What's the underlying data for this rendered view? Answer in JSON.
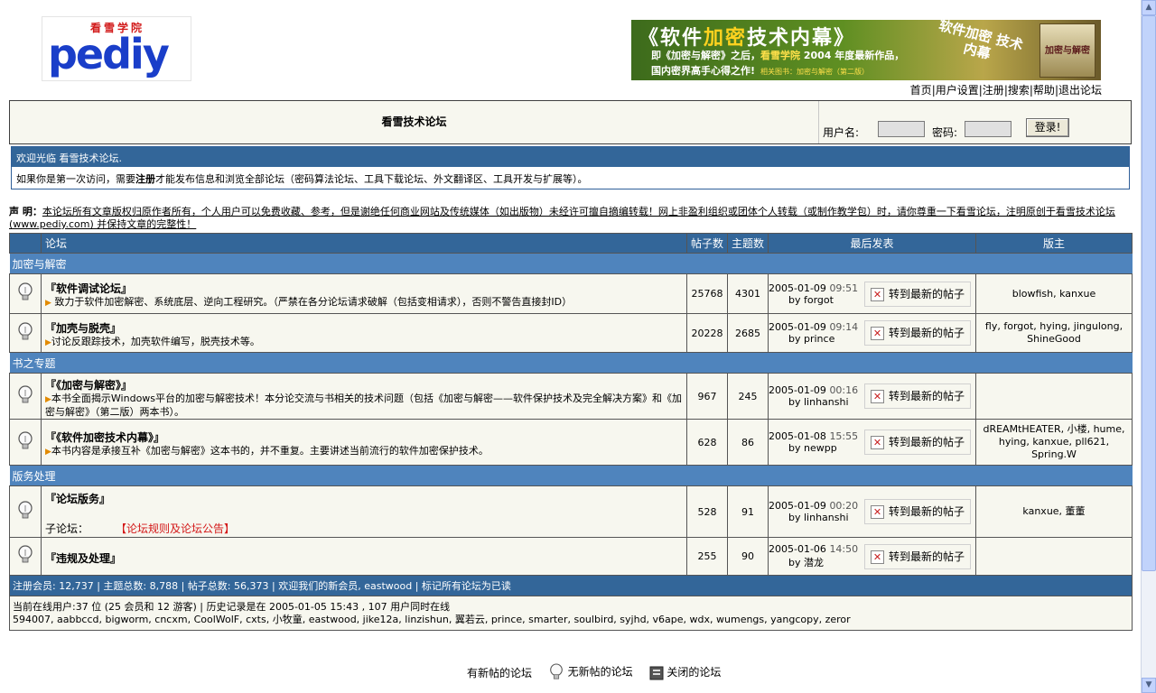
{
  "header": {
    "logo_top": "看雪学院",
    "logo_word": "pediy",
    "banner": {
      "title_open": "《软件",
      "title_hl": "加密",
      "title_close": "技术内幕》",
      "sub1_a": "即《加密与解密》之后，",
      "sub1_hl": "看雪学院",
      "sub1_b": " 2004 年度最新作品，",
      "sub2": "国内密界高手心得之作!",
      "sub2_small": "相关图书：加密与解密（第二版）",
      "slogan": "软件加密 技术内幕",
      "book": "加密与解密"
    },
    "links": [
      "首页",
      "用户设置",
      "注册",
      "搜索",
      "帮助",
      "退出论坛"
    ]
  },
  "title": "看雪技术论坛",
  "login": {
    "username_label": "用户名:",
    "password_label": "密码:",
    "button": "登录!"
  },
  "welcome": {
    "head": "欢迎光临 看雪技术论坛.",
    "body_a": "如果你是第一次访问，需要",
    "body_b": "注册",
    "body_c": "才能发布信息和浏览全部论坛（密码算法论坛、工具下载论坛、外文翻译区、工具开发与扩展等）。"
  },
  "notice": {
    "label": "声 明：",
    "text": "本论坛所有文章版权归原作者所有，个人用户可以免费收藏、参考，但是谢绝任何商业网站及传统媒体（如出版物）未经许可擅自摘编转载！网上非盈利组织或团体个人转载（或制作教学包）时，请你尊重一下看雪论坛，注明原创于看雪技术论坛(www.pediy.com) 并保持文章的完整性！"
  },
  "table": {
    "headers": {
      "forum": "论坛",
      "posts": "帖子数",
      "topics": "主题数",
      "last": "最后发表",
      "mods": "版主"
    },
    "goto_label": "转到最新的帖子",
    "categories": [
      {
        "name": "加密与解密",
        "forums": [
          {
            "name": "『软件调试论坛』",
            "desc": " 致力于软件加密解密、系统底层、逆向工程研究。（严禁在各分论坛请求破解（包括变相请求），否则不警告直接封ID）",
            "posts": "25768",
            "topics": "4301",
            "date": "2005-01-09",
            "time": "09:51",
            "by": "by forgot",
            "mods": "blowfish, kanxue"
          },
          {
            "name": "『加壳与脱壳』",
            "desc": "讨论反跟踪技术，加壳软件编写，脱壳技术等。",
            "posts": "20228",
            "topics": "2685",
            "date": "2005-01-09",
            "time": "09:14",
            "by": "by prince",
            "mods": "fly, forgot, hying, jingulong, ShineGood"
          }
        ]
      },
      {
        "name": "书之专题",
        "forums": [
          {
            "name": "『《加密与解密》』",
            "desc": "本书全面揭示Windows平台的加密与解密技术！本分论交流与书相关的技术问题（包括《加密与解密——软件保护技术及完全解决方案》和《加密与解密》（第二版）两本书）。",
            "posts": "967",
            "topics": "245",
            "date": "2005-01-09",
            "time": "00:16",
            "by": "by linhanshi",
            "mods": ""
          },
          {
            "name": "『《软件加密技术内幕》』",
            "desc": "本书内容是承接互补《加密与解密》这本书的，并不重复。主要讲述当前流行的软件加密保护技术。",
            "posts": "628",
            "topics": "86",
            "date": "2005-01-08",
            "time": "15:55",
            "by": "by newpp",
            "mods": "dREAMtHEATER, 小楼, hume, hying, kanxue, pll621, Spring.W"
          }
        ]
      },
      {
        "name": "版务处理",
        "forums": [
          {
            "name": "『论坛版务』",
            "desc": "",
            "sub_label": "子论坛：",
            "sub_link": "【论坛规则及论坛公告】",
            "posts": "528",
            "topics": "91",
            "date": "2005-01-09",
            "time": "00:20",
            "by": "by linhanshi",
            "mods": "kanxue, 董董"
          },
          {
            "name": "『违规及处理』",
            "desc": "",
            "posts": "255",
            "topics": "90",
            "date": "2005-01-06",
            "time": "14:50",
            "by": "by 潜龙",
            "mods": ""
          }
        ]
      }
    ],
    "stats": {
      "members": "注册会员: 12,737",
      "topics": "主题总数: 8,788",
      "posts": "帖子总数: 56,373",
      "newest": "欢迎我们的新会员, eastwood",
      "mark_read": "标记所有论坛为已读"
    },
    "online": {
      "summary": "当前在线用户:37 位 (25 会员和 12 游客) | 历史记录是在 2005-01-05 15:43 , 107 用户同时在线",
      "users": "594007, aabbccd, bigworm, cncxm, CoolWolF, cxts, 小牧童, eastwood, jike12a, linzishun, 翼若云, prince, smarter, soulbird, syjhd, v6ape, wdx, wumengs, yangcopy, zeror"
    }
  },
  "legend": {
    "new": "有新帖的论坛",
    "no_new": "无新帖的论坛",
    "closed": "关闭的论坛"
  },
  "colors": {
    "header_blue": "#336699",
    "category_blue": "#4f84bd",
    "row_bg": "#f7f7ef",
    "accent_red": "#d31717"
  }
}
